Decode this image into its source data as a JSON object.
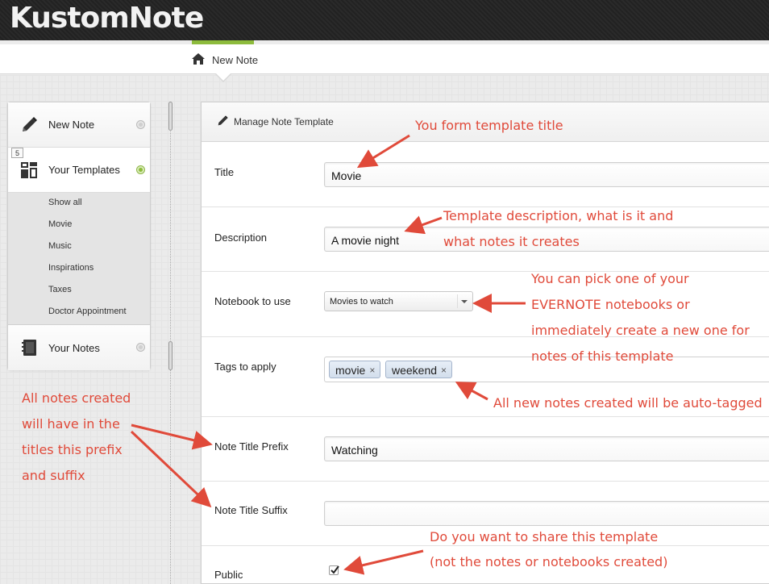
{
  "app": {
    "logo": "KustomNote"
  },
  "breadcrumb": {
    "label": "New Note",
    "icon": "home-icon"
  },
  "colors": {
    "accent_green": "#8dbb3c",
    "annotation_red": "#e04a3a"
  },
  "sidebar": {
    "items": [
      {
        "label": "New Note",
        "icon": "pencil-icon"
      },
      {
        "label": "Your Templates",
        "icon": "templates-icon",
        "badge": "5",
        "active": true
      },
      {
        "label": "Your Notes",
        "icon": "notebook-icon"
      }
    ],
    "template_list": [
      "Show all",
      "Movie",
      "Music",
      "Inspirations",
      "Taxes",
      "Doctor Appointment"
    ]
  },
  "panel": {
    "title": "Manage Note Template",
    "title_icon": "pencil-icon",
    "fields": {
      "title": {
        "label": "Title",
        "value": "Movie"
      },
      "description": {
        "label": "Description",
        "value": "A movie night"
      },
      "notebook": {
        "label": "Notebook to use",
        "value": "Movies to watch"
      },
      "tags": {
        "label": "Tags to apply",
        "values": [
          "movie",
          "weekend"
        ],
        "remove_glyph": "×"
      },
      "prefix": {
        "label": "Note Title Prefix",
        "value": "Watching"
      },
      "suffix": {
        "label": "Note Title Suffix",
        "value": ""
      },
      "public": {
        "label": "Public",
        "checked": true
      }
    }
  },
  "annotations": {
    "title": "You form template title",
    "description": [
      "Template description, what is it and",
      "what notes it creates"
    ],
    "notebook": [
      "You can pick one of your",
      "EVERNOTE notebooks or",
      "immediately create a new one for",
      "notes of this template"
    ],
    "tags": "All new notes created will be auto-tagged",
    "prefix_suffix": [
      "All notes created",
      "will have in the",
      "titles this prefix",
      "and suffix"
    ],
    "public": [
      "Do you want to share this template",
      "(not the notes or notebooks created)"
    ]
  }
}
